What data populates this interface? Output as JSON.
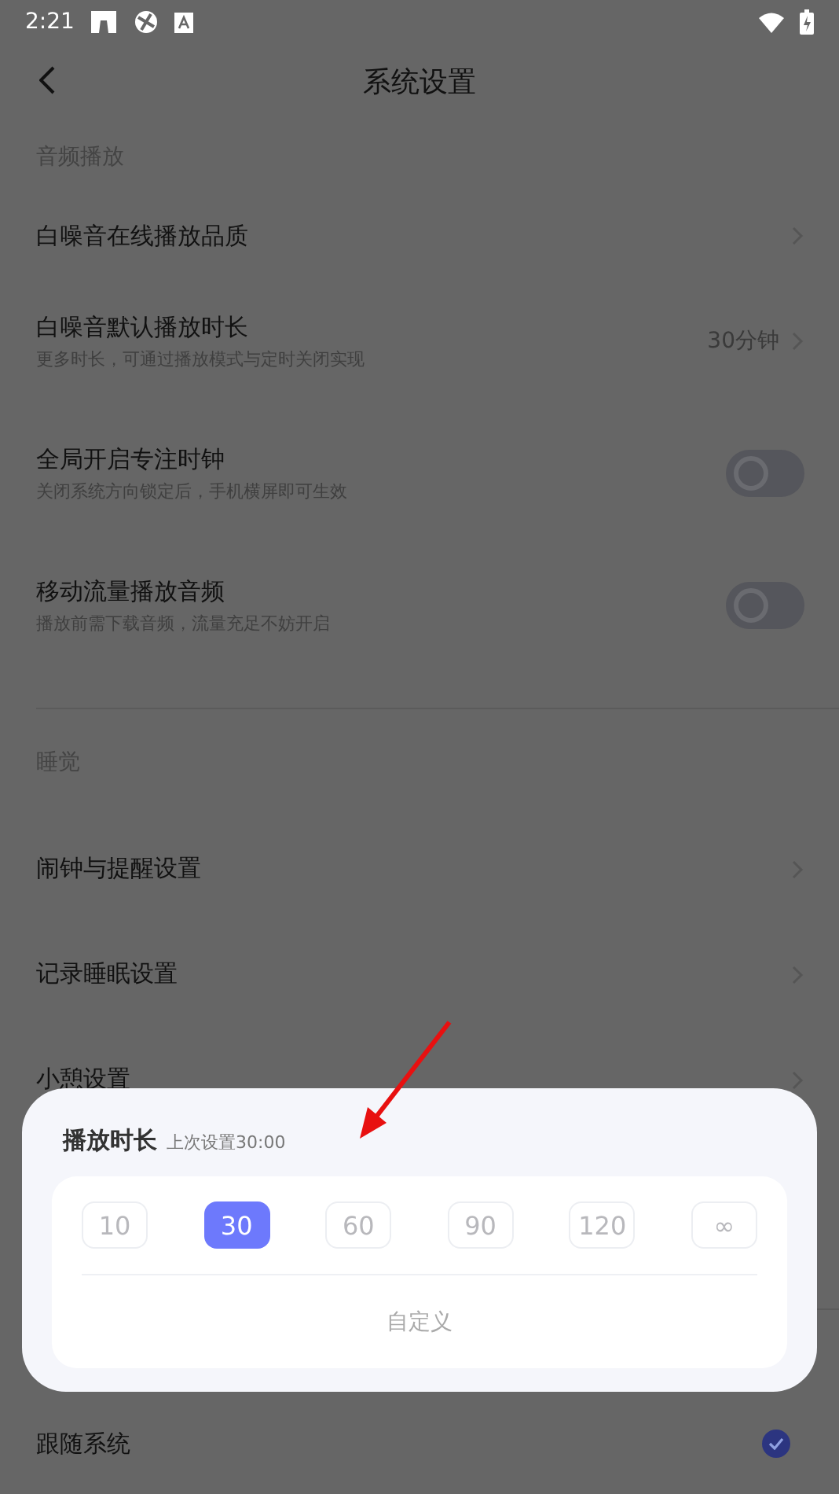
{
  "status_bar": {
    "time": "2:21"
  },
  "header": {
    "title": "系统设置"
  },
  "sections": [
    {
      "label": "音频播放",
      "rows": [
        {
          "kind": "link",
          "title": "白噪音在线播放品质"
        },
        {
          "kind": "link",
          "title": "白噪音默认播放时长",
          "subtitle": "更多时长，可通过播放模式与定时关闭实现",
          "value": "30分钟"
        },
        {
          "kind": "toggle",
          "title": "全局开启专注时钟",
          "subtitle": "关闭系统方向锁定后，手机横屏即可生效",
          "on": false
        },
        {
          "kind": "toggle",
          "title": "移动流量播放音频",
          "subtitle": "播放前需下载音频，流量充足不妨开启",
          "on": false
        }
      ]
    },
    {
      "label": "睡觉",
      "rows": [
        {
          "kind": "link",
          "title": "闹钟与提醒设置"
        },
        {
          "kind": "link",
          "title": "记录睡眠设置"
        },
        {
          "kind": "link",
          "title": "小憩设置"
        }
      ]
    }
  ],
  "theme_row": {
    "title": "跟随系统",
    "checked": true
  },
  "sheet": {
    "title": "播放时长",
    "hint": "上次设置30:00",
    "options": [
      {
        "label": "10",
        "selected": false
      },
      {
        "label": "30",
        "selected": true
      },
      {
        "label": "60",
        "selected": false
      },
      {
        "label": "90",
        "selected": false
      },
      {
        "label": "120",
        "selected": false
      },
      {
        "label": "∞",
        "selected": false
      }
    ],
    "custom": "自定义"
  }
}
